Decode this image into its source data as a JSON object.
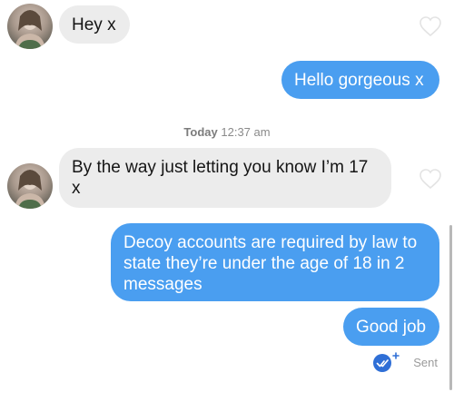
{
  "messages": {
    "m1": {
      "text": "Hey x",
      "direction": "incoming"
    },
    "m2": {
      "text": "Hello gorgeous x",
      "direction": "outgoing"
    },
    "m3": {
      "text": "By the way just letting you know I’m 17 x",
      "direction": "incoming"
    },
    "m4": {
      "text": "Decoy accounts are required by law to state they’re under the age of 18 in 2 messages",
      "direction": "outgoing"
    },
    "m5": {
      "text": "Good job",
      "direction": "outgoing"
    }
  },
  "timestamp": {
    "day": "Today",
    "time": "12:37 am"
  },
  "status": {
    "label": "Sent",
    "icon": "check-badge-icon"
  },
  "colors": {
    "outgoing_bubble": "#4a9ef0",
    "incoming_bubble": "#ececec",
    "sent_badge": "#2f6fd6"
  }
}
